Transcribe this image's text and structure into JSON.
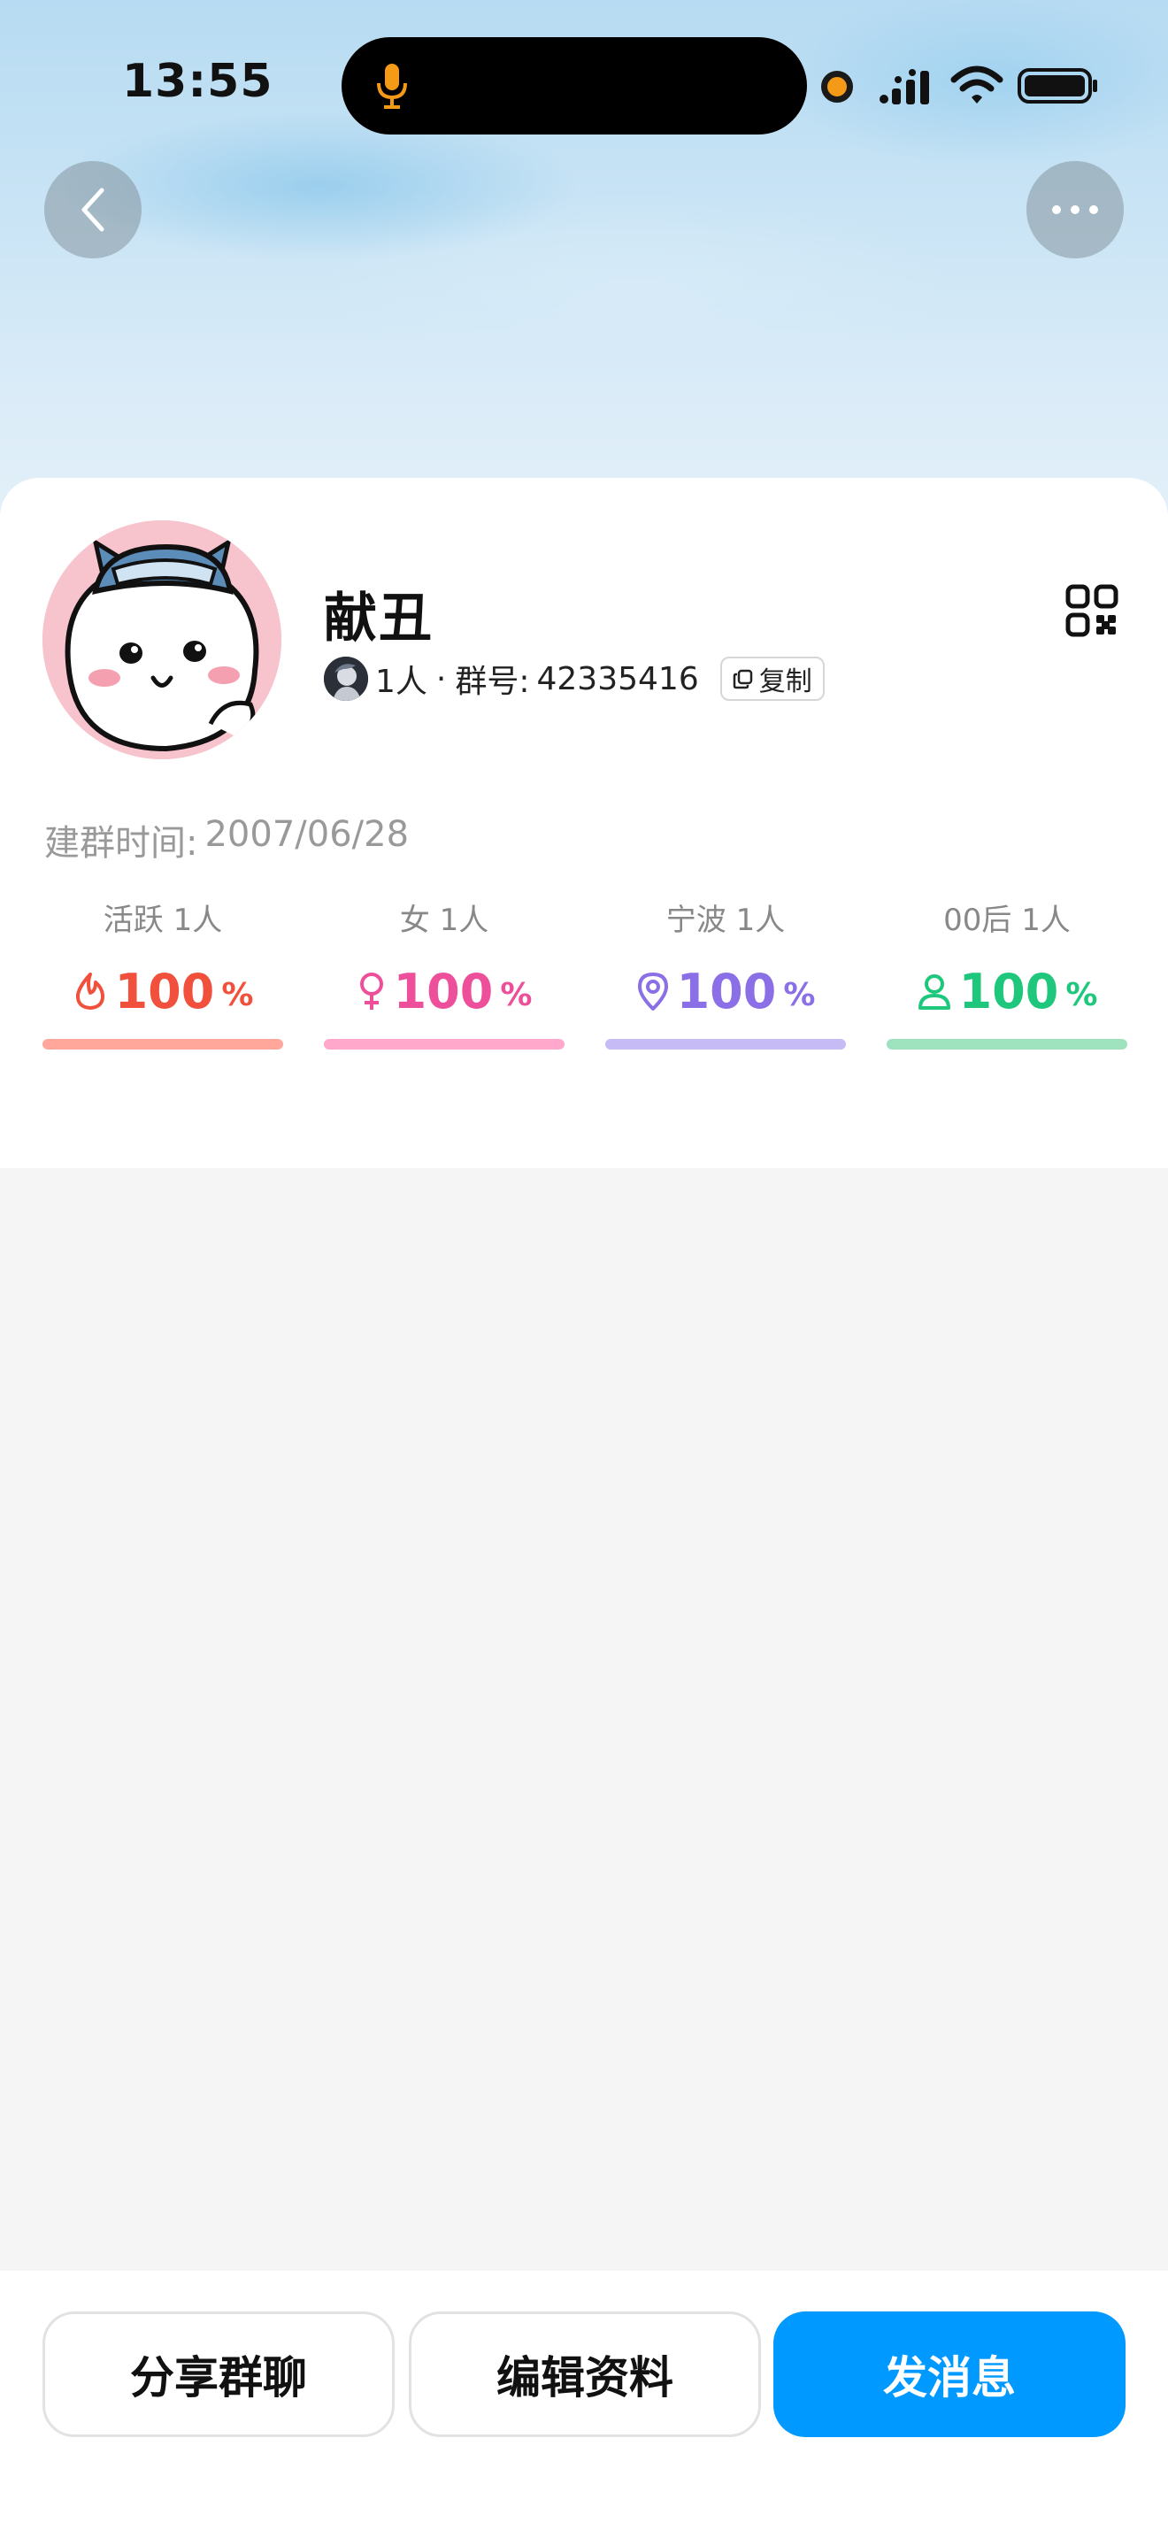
{
  "status_bar": {
    "time": "13:55"
  },
  "header": {
    "back_icon": "chevron-left-icon",
    "more_icon": "ellipsis-icon"
  },
  "profile": {
    "name": "献丑",
    "member_count": "1人",
    "separator": "·",
    "group_id_label": "群号:",
    "group_id": "42335416",
    "copy_label": "复制",
    "created_label": "建群时间:",
    "created_date": "2007/06/28"
  },
  "stats": [
    {
      "label": "活跃 1人",
      "value": "100",
      "unit": "%",
      "icon": "flame-icon",
      "color": "#f0503c",
      "bar_color": "#ffa79a",
      "percent": 100
    },
    {
      "label": "女 1人",
      "value": "100",
      "unit": "%",
      "icon": "female-icon",
      "color": "#ee4f9a",
      "bar_color": "#ffa8cc",
      "percent": 100
    },
    {
      "label": "宁波 1人",
      "value": "100",
      "unit": "%",
      "icon": "location-pin-icon",
      "color": "#8a6fe6",
      "bar_color": "#c7bbf6",
      "percent": 100
    },
    {
      "label": "00后 1人",
      "value": "100",
      "unit": "%",
      "icon": "person-icon",
      "color": "#1ec77b",
      "bar_color": "#9fe3be",
      "percent": 100
    }
  ],
  "actions": {
    "share": "分享群聊",
    "edit": "编辑资料",
    "send": "发消息"
  },
  "colors": {
    "primary": "#0099ff",
    "background": "#f5f5f5",
    "card": "#ffffff"
  }
}
